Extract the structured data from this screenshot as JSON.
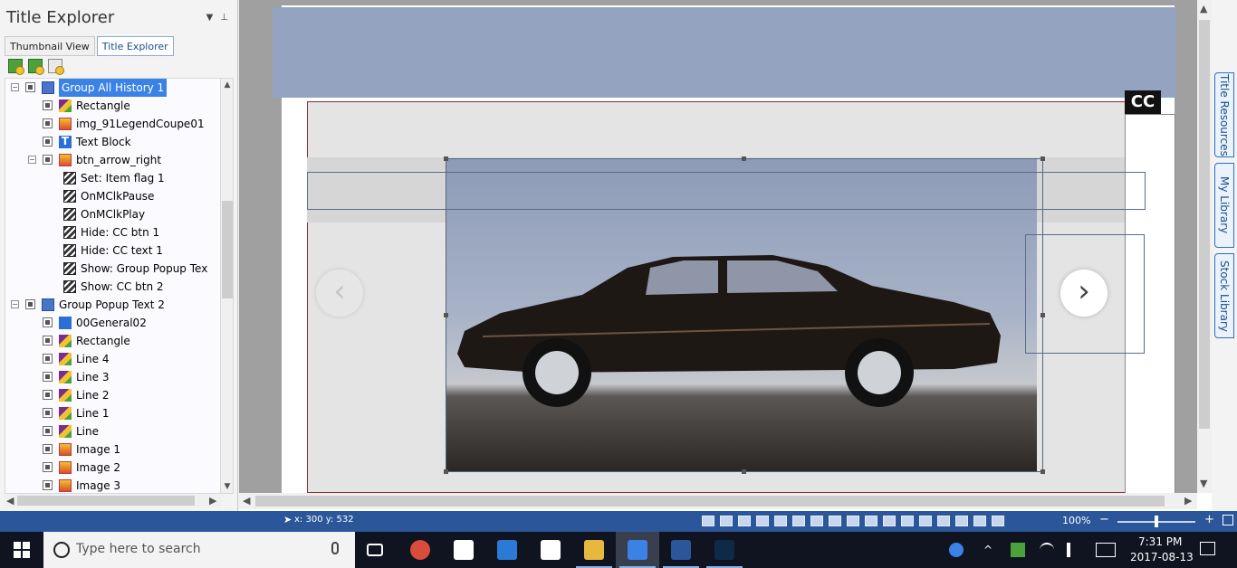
{
  "panel": {
    "title": "Title Explorer",
    "tabs": [
      {
        "label": "Thumbnail View",
        "active": false
      },
      {
        "label": "Title Explorer",
        "active": true
      }
    ],
    "tree": [
      {
        "label": "Group All History 1",
        "icon": "group-icon",
        "level": 0,
        "selected": true
      },
      {
        "label": "Rectangle",
        "icon": "shape-icon",
        "level": 1
      },
      {
        "label": "img_91LegendCoupe01",
        "icon": "image-icon",
        "level": 1
      },
      {
        "label": "Text Block",
        "icon": "text-icon",
        "level": 1
      },
      {
        "label": "btn_arrow_right",
        "icon": "image-icon",
        "level": 1
      },
      {
        "label": "Set: Item flag 1",
        "icon": "action-icon",
        "level": 2
      },
      {
        "label": "OnMClkPause",
        "icon": "action-icon",
        "level": 2
      },
      {
        "label": "OnMClkPlay",
        "icon": "action-icon",
        "level": 2
      },
      {
        "label": "Hide: CC btn 1",
        "icon": "action-icon",
        "level": 2
      },
      {
        "label": "Hide: CC text 1",
        "icon": "action-icon",
        "level": 2
      },
      {
        "label": "Show: Group Popup Tex",
        "icon": "action-icon",
        "level": 2
      },
      {
        "label": "Show: CC btn 2",
        "icon": "action-icon",
        "level": 2
      },
      {
        "label": "Group Popup Text 2",
        "icon": "group-icon",
        "level": 0
      },
      {
        "label": "00General02",
        "icon": "audio-icon",
        "level": 1
      },
      {
        "label": "Rectangle",
        "icon": "shape-icon",
        "level": 1
      },
      {
        "label": "Line 4",
        "icon": "shape-icon",
        "level": 1
      },
      {
        "label": "Line 3",
        "icon": "shape-icon",
        "level": 1
      },
      {
        "label": "Line 2",
        "icon": "shape-icon",
        "level": 1
      },
      {
        "label": "Line 1",
        "icon": "shape-icon",
        "level": 1
      },
      {
        "label": "Line",
        "icon": "shape-icon",
        "level": 1
      },
      {
        "label": "Image 1",
        "icon": "image-icon",
        "level": 1
      },
      {
        "label": "Image 2",
        "icon": "image-icon",
        "level": 1
      },
      {
        "label": "Image 3",
        "icon": "image-icon",
        "level": 1
      }
    ]
  },
  "canvas": {
    "cc_label": "CC",
    "prev_arrow": "‹",
    "next_arrow": "›"
  },
  "side_tabs": [
    "Title Resources",
    "My Library",
    "Stock Library"
  ],
  "status": {
    "cursor_readout": "x: 300  y: 532",
    "zoom": "100%",
    "zoom_fraction": 0.5,
    "minus": "−",
    "plus": "+"
  },
  "taskbar": {
    "search_placeholder": "Type here to search",
    "apps": [
      {
        "name": "task-view",
        "running": false,
        "active": false
      },
      {
        "name": "chrome",
        "running": false,
        "active": false
      },
      {
        "name": "dropbox",
        "running": false,
        "active": false
      },
      {
        "name": "edge",
        "running": false,
        "active": false
      },
      {
        "name": "store",
        "running": false,
        "active": false
      },
      {
        "name": "file-explorer",
        "running": true,
        "active": false
      },
      {
        "name": "lectora",
        "running": true,
        "active": true
      },
      {
        "name": "word",
        "running": true,
        "active": false
      },
      {
        "name": "photoshop",
        "running": true,
        "active": false
      }
    ],
    "time": "7:31 PM",
    "date": "2017-08-13"
  },
  "colors": {
    "accent": "#2b579a",
    "selection": "#3b82e6",
    "banner": "#94a3c0"
  }
}
